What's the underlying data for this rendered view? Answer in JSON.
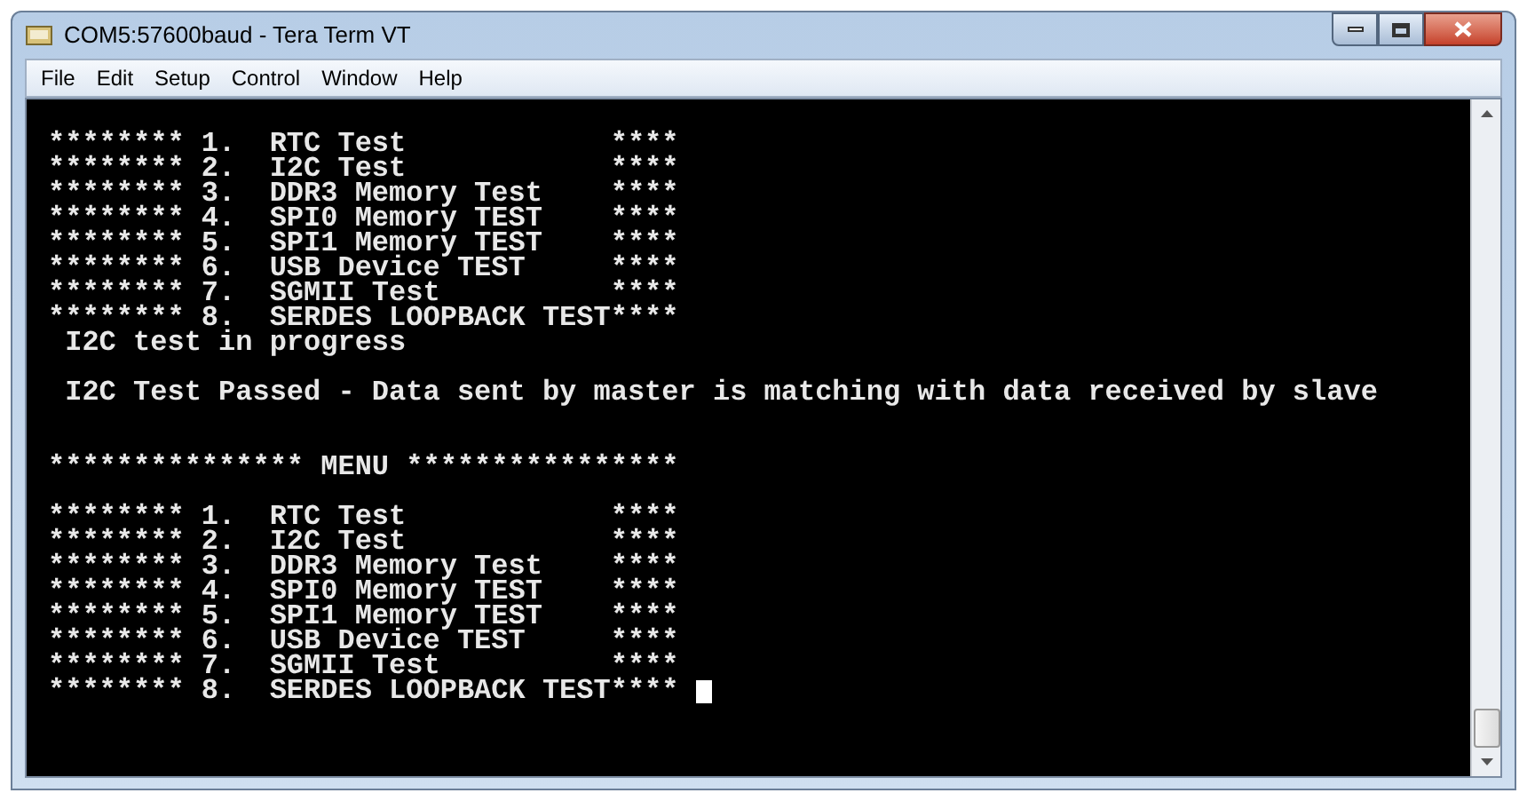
{
  "window": {
    "title": "COM5:57600baud - Tera Term VT"
  },
  "menu": [
    "File",
    "Edit",
    "Setup",
    "Control",
    "Window",
    "Help"
  ],
  "terminal": {
    "lines": [
      {
        "kind": "blank"
      },
      {
        "kind": "text",
        "text": "******** 1.  RTC Test            ****"
      },
      {
        "kind": "text",
        "text": "******** 2.  I2C Test            ****"
      },
      {
        "kind": "text",
        "text": "******** 3.  DDR3 Memory Test    ****"
      },
      {
        "kind": "text",
        "text": "******** 4.  SPI0 Memory TEST    ****"
      },
      {
        "kind": "text",
        "text": "******** 5.  SPI1 Memory TEST    ****"
      },
      {
        "kind": "text",
        "text": "******** 6.  USB Device TEST     ****"
      },
      {
        "kind": "text",
        "text": "******** 7.  SGMII Test          ****"
      },
      {
        "kind": "text",
        "text": "******** 8.  SERDES LOOPBACK TEST****"
      },
      {
        "kind": "text",
        "text": " I2C test in progress"
      },
      {
        "kind": "blank"
      },
      {
        "kind": "text",
        "text": " I2C Test Passed - Data sent by master is matching with data received by slave"
      },
      {
        "kind": "blank"
      },
      {
        "kind": "blank"
      },
      {
        "kind": "text",
        "text": "*************** MENU ****************"
      },
      {
        "kind": "blank"
      },
      {
        "kind": "text",
        "text": "******** 1.  RTC Test            ****"
      },
      {
        "kind": "text",
        "text": "******** 2.  I2C Test            ****"
      },
      {
        "kind": "text",
        "text": "******** 3.  DDR3 Memory Test    ****"
      },
      {
        "kind": "text",
        "text": "******** 4.  SPI0 Memory TEST    ****"
      },
      {
        "kind": "text",
        "text": "******** 5.  SPI1 Memory TEST    ****"
      },
      {
        "kind": "text",
        "text": "******** 6.  USB Device TEST     ****"
      },
      {
        "kind": "text",
        "text": "******** 7.  SGMII Test          ****"
      },
      {
        "kind": "prompt",
        "text": "******** 8.  SERDES LOOPBACK TEST****"
      }
    ]
  }
}
